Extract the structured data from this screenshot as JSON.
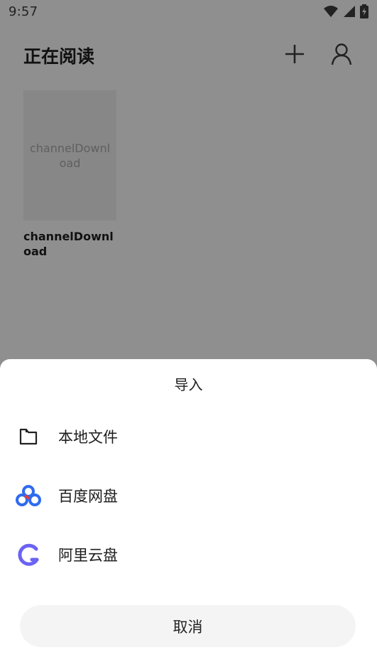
{
  "status_bar": {
    "time": "9:57"
  },
  "header": {
    "title": "正在阅读"
  },
  "books": [
    {
      "cover_text": "channelDownload",
      "title": "channelDownload"
    }
  ],
  "import_sheet": {
    "title": "导入",
    "options": [
      {
        "label": "本地文件",
        "icon": "folder-icon"
      },
      {
        "label": "百度网盘",
        "icon": "baidu-netdisk-icon"
      },
      {
        "label": "阿里云盘",
        "icon": "aliyun-drive-icon"
      }
    ],
    "cancel_label": "取消"
  },
  "colors": {
    "overlay_bg": "#8f8f8f",
    "baidu_blue": "#2f6bf0",
    "baidu_red": "#ee3b2f",
    "aliyun_purple": "#6b63f3"
  }
}
